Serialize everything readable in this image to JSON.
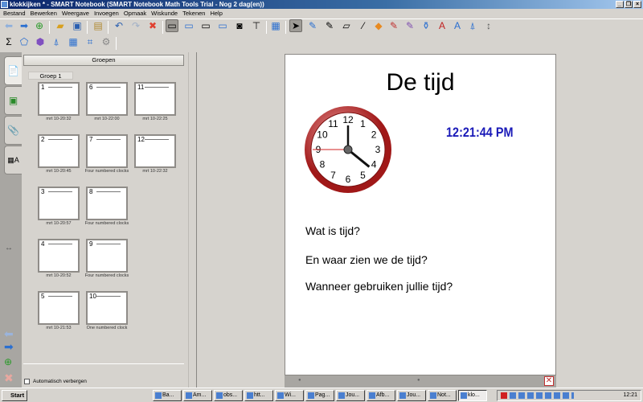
{
  "window": {
    "title": "klokkijken * - SMART Notebook (SMART Notebook Math Tools Trial - Nog 2 dag(en))"
  },
  "menu": [
    "Bestand",
    "Bewerken",
    "Weergave",
    "Invoegen",
    "Opmaak",
    "Wiskunde",
    "Tekenen",
    "Help"
  ],
  "sidepanel": {
    "groups_button": "Groepen",
    "group_label": "Groep 1",
    "autohide_label": "Automatisch verbergen",
    "autohide_checked": false,
    "thumbnails": [
      {
        "num": "1",
        "label": "mrt 10-20:32"
      },
      {
        "num": "6",
        "label": "mrt 10-22:00"
      },
      {
        "num": "11",
        "label": "mrt 10-22:25"
      },
      {
        "num": "2",
        "label": "mrt 10-20:45"
      },
      {
        "num": "7",
        "label": "Four numbered clocks"
      },
      {
        "num": "12",
        "label": "mrt 10-22:32"
      },
      {
        "num": "3",
        "label": "mrt 10-20:57"
      },
      {
        "num": "8",
        "label": "Four numbered clocks"
      },
      {
        "num": "4",
        "label": "mrt 10-20:52"
      },
      {
        "num": "9",
        "label": "Four numbered clocks"
      },
      {
        "num": "5",
        "label": "mrt 10-21:53"
      },
      {
        "num": "10",
        "label": "One numbered clock"
      }
    ]
  },
  "page": {
    "title": "De tijd",
    "digital_clock": "12:21:44 PM",
    "questions": [
      "Wat is tijd?",
      "En waar zien we de tijd?",
      "Wanneer gebruiken jullie tijd?"
    ],
    "analog_clock": {
      "numbers": [
        "12",
        "1",
        "2",
        "3",
        "4",
        "5",
        "6",
        "7",
        "8",
        "9",
        "10",
        "11"
      ],
      "hour": 4.3,
      "minute": 0,
      "second": 45
    }
  },
  "taskbar": {
    "start": "Start",
    "tasks": [
      "Ba...",
      "Am...",
      "obs...",
      "htt...",
      "Wi...",
      "Pag...",
      "Jou...",
      "Afb...",
      "Jou...",
      "Not...",
      "klo..."
    ],
    "clock": "12:21"
  }
}
